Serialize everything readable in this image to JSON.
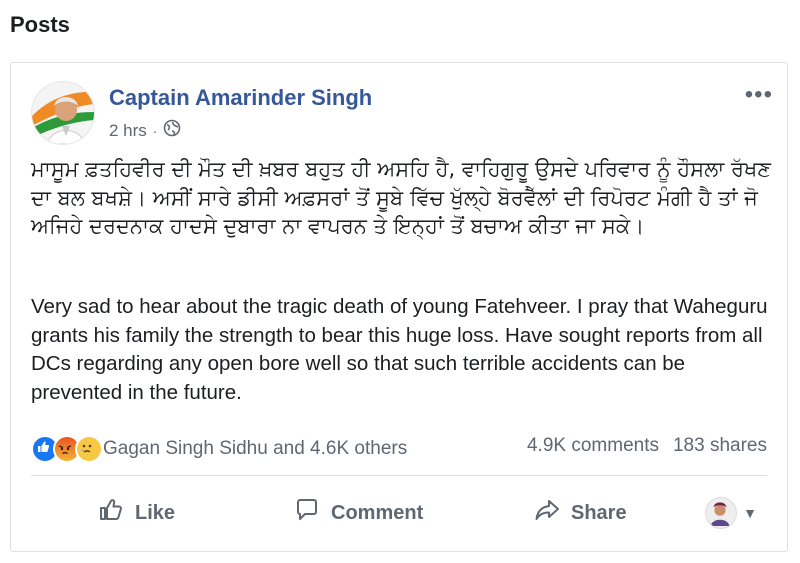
{
  "section": {
    "title": "Posts"
  },
  "post": {
    "author": "Captain Amarinder Singh",
    "time": "2 hrs",
    "more_label": "•••",
    "text_punjabi": "ਮਾਸੂਮ ਫ਼ਤਹਿਵੀਰ ਦੀ ਮੌਤ ਦੀ ਖ਼ਬਰ ਬਹੁਤ ਹੀ ਅਸਹਿ ਹੈ, ਵਾਹਿਗੁਰੂ ਉਸਦੇ ਪਰਿਵਾਰ ਨੂੰ ਹੌਸਲਾ ਰੱਖਣ ਦਾ ਬਲ ਬਖਸ਼ੇ। ਅਸੀਂ ਸਾਰੇ ਡੀਸੀ ਅਫ਼ਸਰਾਂ ਤੋਂ ਸੂਬੇ ਵਿੱਚ ਖੁੱਲ੍ਹੇ ਬੋਰਵੈੱਲਾਂ ਦੀ ਰਿਪੋਰਟ ਮੰਗੀ ਹੈ ਤਾਂ ਜੋ ਅਜਿਹੇ ਦਰਦਨਾਕ ਹਾਦਸੇ ਦੁਬਾਰਾ ਨਾ ਵਾਪਰਨ ਤੇ ਇਨ੍ਹਾਂ ਤੋਂ ਬਚਾਅ ਕੀਤਾ ਜਾ ਸਕੇ।",
    "text_english": "Very sad to hear about the tragic death of young Fatehveer. I pray that Waheguru grants his family the strength to bear this huge loss. Have sought reports from all DCs regarding any open bore well so that such terrible accidents can be prevented in the future.",
    "reactions": {
      "types": [
        "like",
        "angry",
        "sad"
      ],
      "summary": "Gagan Singh Sidhu and 4.6K others"
    },
    "comments_count": "4.9K comments",
    "shares_count": "183 shares",
    "actions": {
      "like": "Like",
      "comment": "Comment",
      "share": "Share"
    }
  },
  "colors": {
    "author_link": "#365899",
    "secondary_text": "#606770",
    "like_blue": "#1877f2"
  },
  "icons": [
    "globe-icon",
    "thumbs-up-icon",
    "comment-icon",
    "share-icon",
    "more-icon",
    "caret-down-icon"
  ]
}
